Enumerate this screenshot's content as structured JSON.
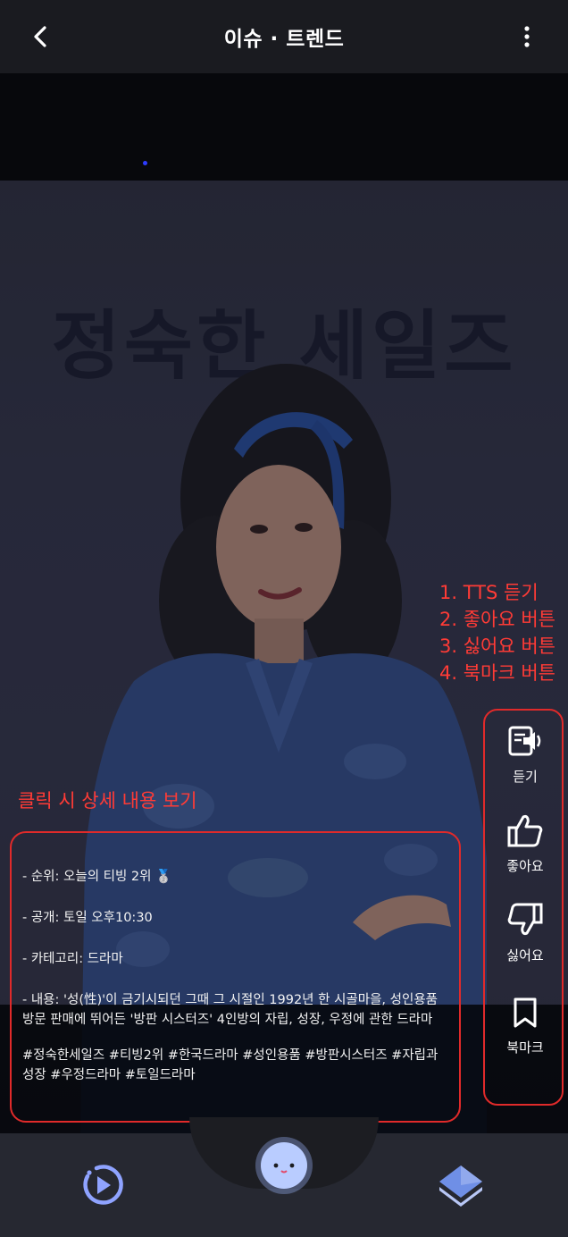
{
  "header": {
    "title": "이슈 · 트렌드",
    "back_icon": "back-arrow-icon",
    "more_icon": "more-vertical-icon"
  },
  "poster": {
    "title_text": "정숙한 세일즈"
  },
  "annotations": {
    "list": [
      "1. TTS 듣기",
      "2. 좋아요 버튼",
      "3. 싫어요 버튼",
      "4. 북마크 버튼"
    ],
    "click_hint": "클릭 시 상세 내용 보기",
    "color": "#ff3b36"
  },
  "actions": [
    {
      "icon": "tts-speaker-icon",
      "label": "듣기"
    },
    {
      "icon": "thumbs-up-icon",
      "label": "좋아요"
    },
    {
      "icon": "thumbs-down-icon",
      "label": "싫어요"
    },
    {
      "icon": "bookmark-icon",
      "label": "북마크"
    }
  ],
  "description": {
    "rank": "- 순위: 오늘의 티빙 2위 🥈",
    "release": "- 공개: 토일 오후10:30",
    "category": "- 카테고리: 드라마",
    "content": "- 내용: '성(性)'이 금기시되던 그때 그 시절인 1992년 한 시골마을, 성인용품 방문 판매에 뛰어든 '방판 시스터즈' 4인방의 자립, 성장, 우정에 관한 드라마",
    "hashtags": "#정숙한세일즈 #티빙2위 #한국드라마 #성인용품 #방판시스터즈 #자립과성장 #우정드라마 #토일드라마"
  },
  "bottom_nav": {
    "left_icon": "replay-play-icon",
    "center_icon": "character-face-icon",
    "right_icon": "layers-cube-icon"
  }
}
